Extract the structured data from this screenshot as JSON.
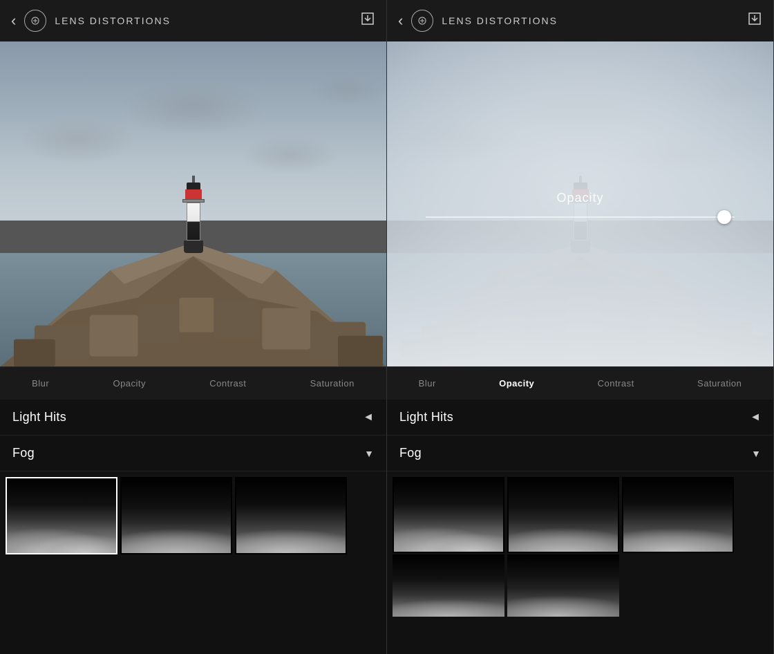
{
  "left_panel": {
    "header": {
      "back_label": "‹",
      "logo_icon": "lens-icon",
      "title": "LENS DISTORTIONS",
      "download_icon": "download-icon"
    },
    "controls": {
      "items": [
        {
          "label": "Blur",
          "active": false
        },
        {
          "label": "Opacity",
          "active": false
        },
        {
          "label": "Contrast",
          "active": false
        },
        {
          "label": "Saturation",
          "active": false
        }
      ]
    },
    "bottom": {
      "light_hits_label": "Light Hits",
      "light_hits_arrow": "◄",
      "fog_label": "Fog",
      "fog_arrow": "▼",
      "thumbnails": [
        {
          "id": 1,
          "selected": true
        },
        {
          "id": 2,
          "selected": false
        },
        {
          "id": 3,
          "selected": false
        }
      ]
    }
  },
  "right_panel": {
    "header": {
      "back_label": "‹",
      "logo_icon": "lens-icon",
      "title": "LENS DISTORTIONS",
      "download_icon": "download-icon"
    },
    "opacity_overlay": {
      "label": "Opacity"
    },
    "controls": {
      "items": [
        {
          "label": "Blur",
          "active": false
        },
        {
          "label": "Opacity",
          "active": true
        },
        {
          "label": "Contrast",
          "active": false
        },
        {
          "label": "Saturation",
          "active": false
        }
      ]
    },
    "bottom": {
      "light_hits_label": "Light Hits",
      "light_hits_arrow": "◄",
      "fog_label": "Fog",
      "fog_arrow": "▼",
      "thumbnails": [
        {
          "id": 1,
          "selected": false
        },
        {
          "id": 2,
          "selected": false
        },
        {
          "id": 3,
          "selected": false
        }
      ]
    }
  }
}
